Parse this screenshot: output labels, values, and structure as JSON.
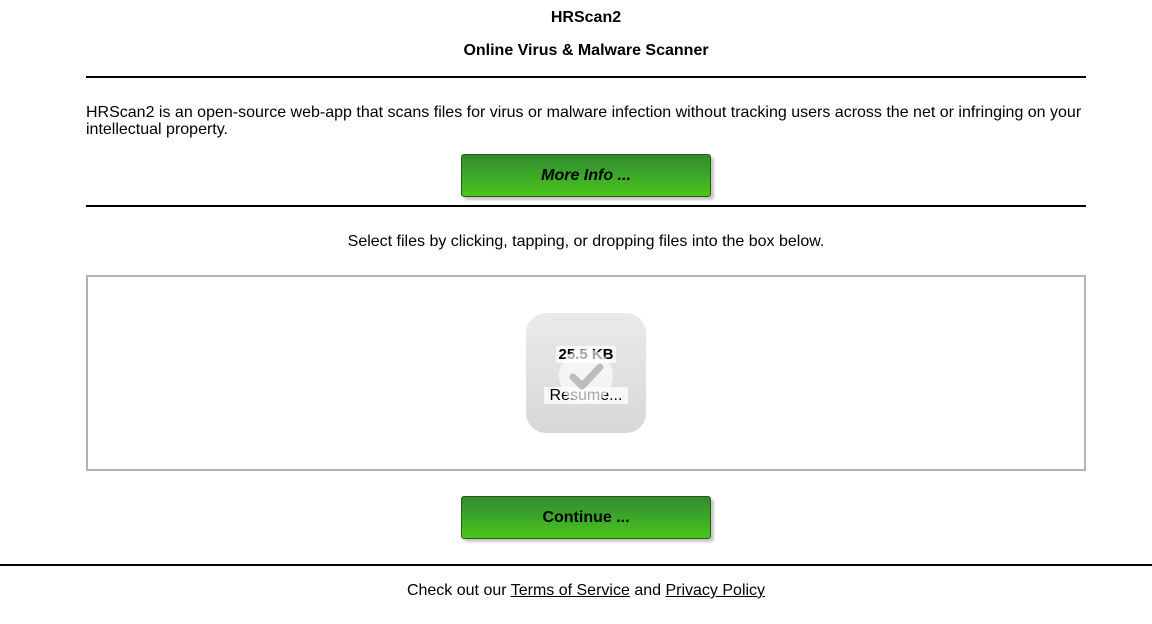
{
  "header": {
    "title": "HRScan2",
    "subtitle": "Online Virus & Malware Scanner"
  },
  "intro": {
    "text": "HRScan2 is an open-source web-app that scans files for virus or malware infection without tracking users across the net or infringing on your intellectual property."
  },
  "buttons": {
    "more_info_label": "More Info ...",
    "continue_label": "Continue ..."
  },
  "upload": {
    "instructions": "Select files by clicking, tapping, or dropping files into the box below.",
    "files": [
      {
        "size": "25.5 KB",
        "name": "Resume...",
        "status_icon": "check-icon"
      }
    ]
  },
  "footer": {
    "prefix": "Check out our",
    "terms_label": "Terms of Service",
    "conjunction": "and",
    "privacy_label": "Privacy Policy"
  }
}
